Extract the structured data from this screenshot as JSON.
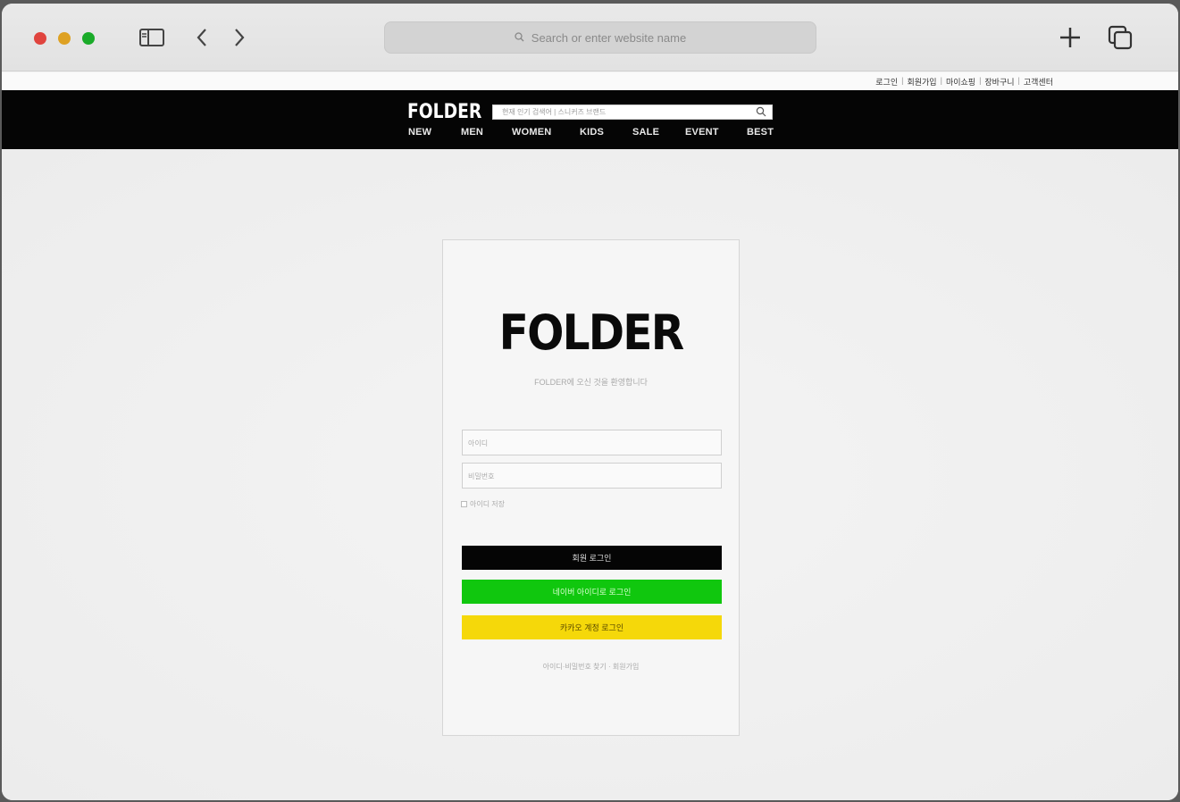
{
  "browser": {
    "address_placeholder": "Search or enter website name"
  },
  "utility_links": [
    "로그인",
    "회원가입",
    "마이쇼핑",
    "장바구니",
    "고객센터"
  ],
  "header": {
    "logo": "FOLDER",
    "search_placeholder": "현재 인기 검색어 | 스니커즈 브랜드",
    "nav": [
      "NEW",
      "MEN",
      "WOMEN",
      "KIDS",
      "SALE",
      "EVENT",
      "BEST"
    ]
  },
  "login": {
    "logo": "FOLDER",
    "tagline": "FOLDER에 오신 것을 환영합니다",
    "id_placeholder": "아이디",
    "pw_placeholder": "비밀번호",
    "save_id": "아이디 저장",
    "member_login": "회원 로그인",
    "naver_login": "네이버 아이디로 로그인",
    "kakao_login": "카카오 계정 로그인",
    "footer_link": "아이디·비밀번호 찾기 · 회원가입"
  },
  "colors": {
    "header_bg": "#050505",
    "naver_green": "#10c70e",
    "kakao_yellow": "#f5d80a"
  }
}
